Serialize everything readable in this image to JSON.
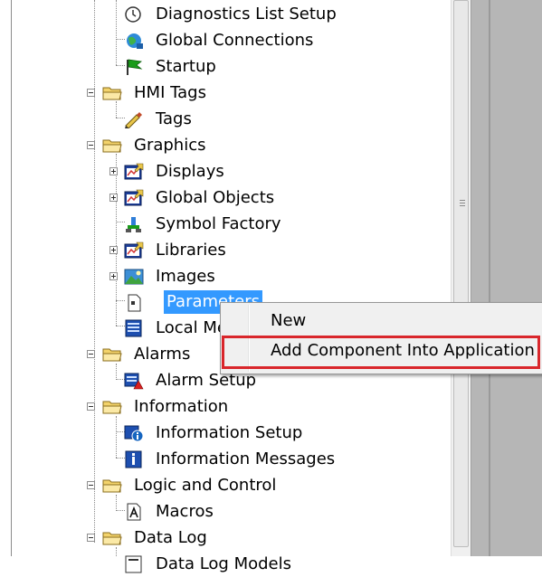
{
  "tree": {
    "items": [
      {
        "label": "Diagnostics List Setup",
        "icon": "diagnostics-clock-icon"
      },
      {
        "label": "Global Connections",
        "icon": "globe-icon"
      },
      {
        "label": "Startup",
        "icon": "green-flag-icon"
      },
      {
        "label": "HMI Tags",
        "icon": "folder-icon",
        "expanded": true
      },
      {
        "label": "Tags",
        "icon": "tag-pencil-icon"
      },
      {
        "label": "Graphics",
        "icon": "folder-icon",
        "expanded": true
      },
      {
        "label": "Displays",
        "icon": "display-icon",
        "expandable": true
      },
      {
        "label": "Global Objects",
        "icon": "display-icon",
        "expandable": true
      },
      {
        "label": "Symbol Factory",
        "icon": "symbol-factory-icon"
      },
      {
        "label": "Libraries",
        "icon": "display-icon",
        "expandable": true
      },
      {
        "label": "Images",
        "icon": "image-icon",
        "expandable": true
      },
      {
        "label": "Parameters",
        "icon": "document-icon",
        "selected": true
      },
      {
        "label": "Local Messages",
        "icon": "local-messages-icon"
      },
      {
        "label": "Alarms",
        "icon": "folder-icon",
        "expanded": true
      },
      {
        "label": "Alarm Setup",
        "icon": "alarm-setup-icon"
      },
      {
        "label": "Information",
        "icon": "folder-icon",
        "expanded": true
      },
      {
        "label": "Information Setup",
        "icon": "info-setup-icon"
      },
      {
        "label": "Information Messages",
        "icon": "info-messages-icon"
      },
      {
        "label": "Logic and Control",
        "icon": "folder-icon",
        "expanded": true
      },
      {
        "label": "Macros",
        "icon": "macro-icon"
      },
      {
        "label": "Data Log",
        "icon": "folder-icon",
        "expanded": true
      },
      {
        "label": "Data Log Models",
        "icon": "data-log-icon"
      }
    ]
  },
  "context_menu": {
    "new_label": "New",
    "add_label": "Add Component Into Application"
  },
  "colors": {
    "selection": "#3399ff",
    "highlight_box": "#d9262b",
    "menu_bg": "#f0f0f0"
  }
}
